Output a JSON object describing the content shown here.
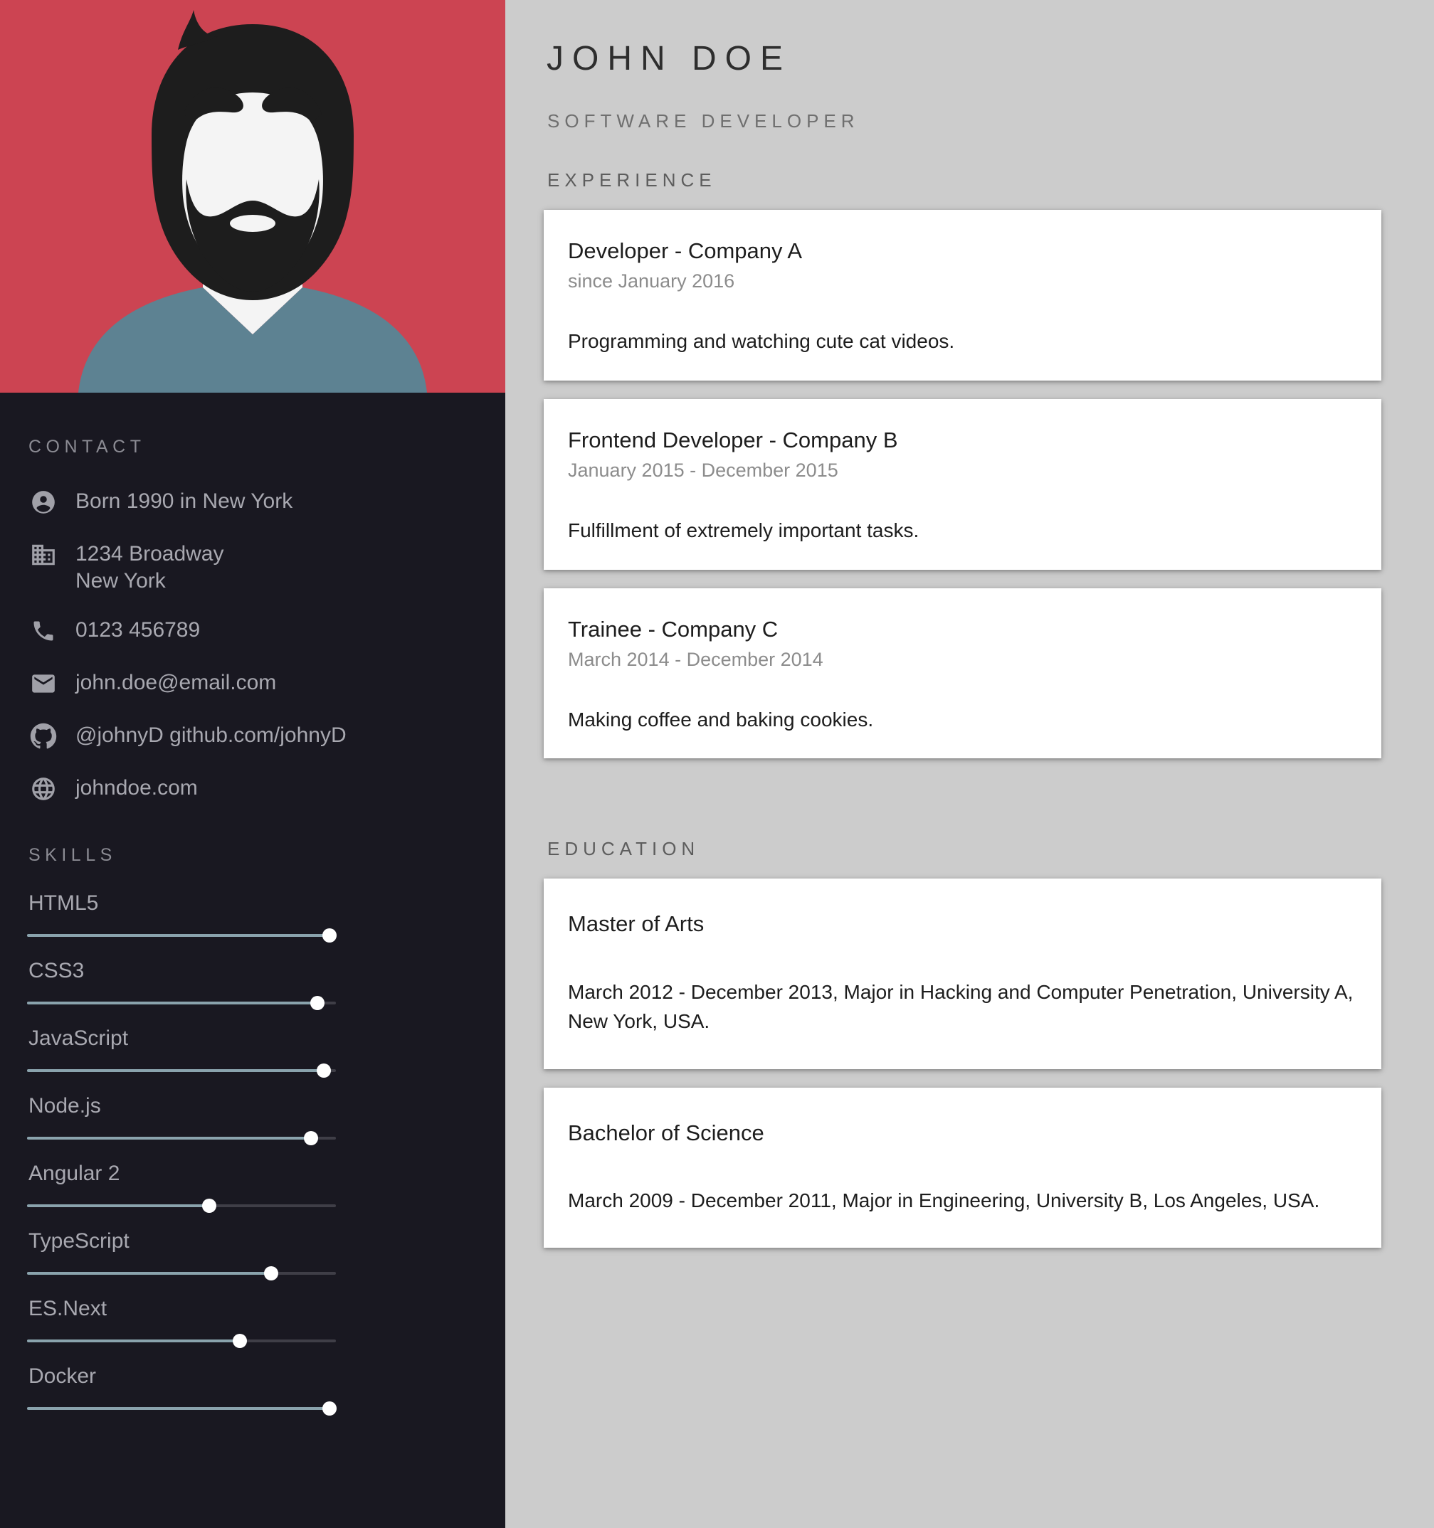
{
  "theme": {
    "accent_red": "#cc4452",
    "sidebar_bg": "#191821",
    "page_bg": "#cccccc",
    "slider_fill": "#8aa3ad",
    "slider_track": "#3f3e47",
    "shirt_blue": "#5d8292"
  },
  "header": {
    "name": "JOHN DOE",
    "role": "SOFTWARE DEVELOPER"
  },
  "sidebar": {
    "avatar": {
      "icon": "avatar-illustration"
    },
    "contact_label": "CONTACT",
    "contact": [
      {
        "icon": "person-icon",
        "text": "Born 1990 in New York"
      },
      {
        "icon": "building-icon",
        "text": "1234 Broadway\nNew York"
      },
      {
        "icon": "phone-icon",
        "text": "0123 456789"
      },
      {
        "icon": "email-icon",
        "text": "john.doe@email.com"
      },
      {
        "icon": "github-icon",
        "text": "@johnyD github.com/johnyD"
      },
      {
        "icon": "globe-icon",
        "text": "johndoe.com"
      }
    ],
    "skills_label": "SKILLS",
    "skills": [
      {
        "name": "HTML5",
        "value": 98
      },
      {
        "name": "CSS3",
        "value": 94
      },
      {
        "name": "JavaScript",
        "value": 96
      },
      {
        "name": "Node.js",
        "value": 92
      },
      {
        "name": "Angular 2",
        "value": 59
      },
      {
        "name": "TypeScript",
        "value": 79
      },
      {
        "name": "ES.Next",
        "value": 69
      },
      {
        "name": "Docker",
        "value": 98
      }
    ]
  },
  "main": {
    "experience_label": "EXPERIENCE",
    "experience": [
      {
        "title": "Developer - Company A",
        "period": "since January 2016",
        "description": "Programming and watching cute cat videos."
      },
      {
        "title": "Frontend Developer - Company B",
        "period": "January 2015 - December 2015",
        "description": "Fulfillment of extremely important tasks."
      },
      {
        "title": "Trainee - Company C",
        "period": "March 2014 - December 2014",
        "description": "Making coffee and baking cookies."
      }
    ],
    "education_label": "EDUCATION",
    "education": [
      {
        "title": "Master of Arts",
        "description": "March 2012 - December 2013, Major in Hacking and Computer Penetration, University A, New York, USA."
      },
      {
        "title": "Bachelor of Science",
        "description": "March 2009 - December 2011, Major in Engineering, University B, Los Angeles, USA."
      }
    ]
  }
}
